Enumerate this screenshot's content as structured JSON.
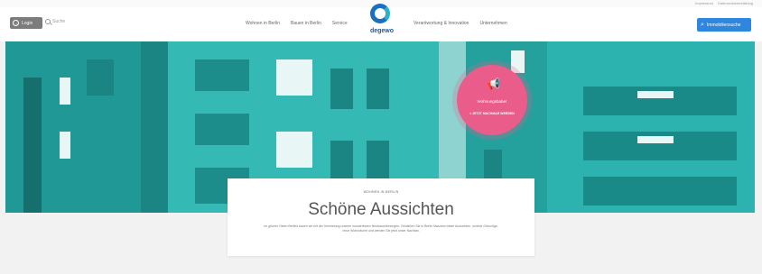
{
  "utility": {
    "links": [
      "Impressum",
      "Datenschutzerklärung"
    ]
  },
  "header": {
    "login_label": "Login",
    "search_placeholder": "Suche",
    "nav_left": [
      "Wohnen in Berlin",
      "Bauen in Berlin",
      "Service"
    ],
    "nav_right": [
      "Verantwortung & Innovation",
      "Unternehmen"
    ],
    "logo_text": "degewo",
    "cta_label": "Immobiliensuche",
    "cta_icon": "search-icon"
  },
  "colors": {
    "brand_blue": "#1a6fbf",
    "teal": "#1e9d9b",
    "pink": "#ea5d8a",
    "cta_blue": "#2e86de"
  },
  "promo": {
    "icon": "megaphone-icon",
    "title": "Wohnungsbaber",
    "link": "> JETZT MACHMAR WERDEN"
  },
  "content": {
    "eyebrow": "WOHNEN IN BERLIN",
    "headline": "Schöne Aussichten",
    "copy": "Im grünen Osten Berlins bauen wir mit der Vermietung unserer wunderbaren Neubauwohnungen. Genießen Sie in Berlin Marzahn beste Aussichten, schöne Grünzüge, neue Wohnräume und werden Sie jetzt unser Nachbar."
  }
}
